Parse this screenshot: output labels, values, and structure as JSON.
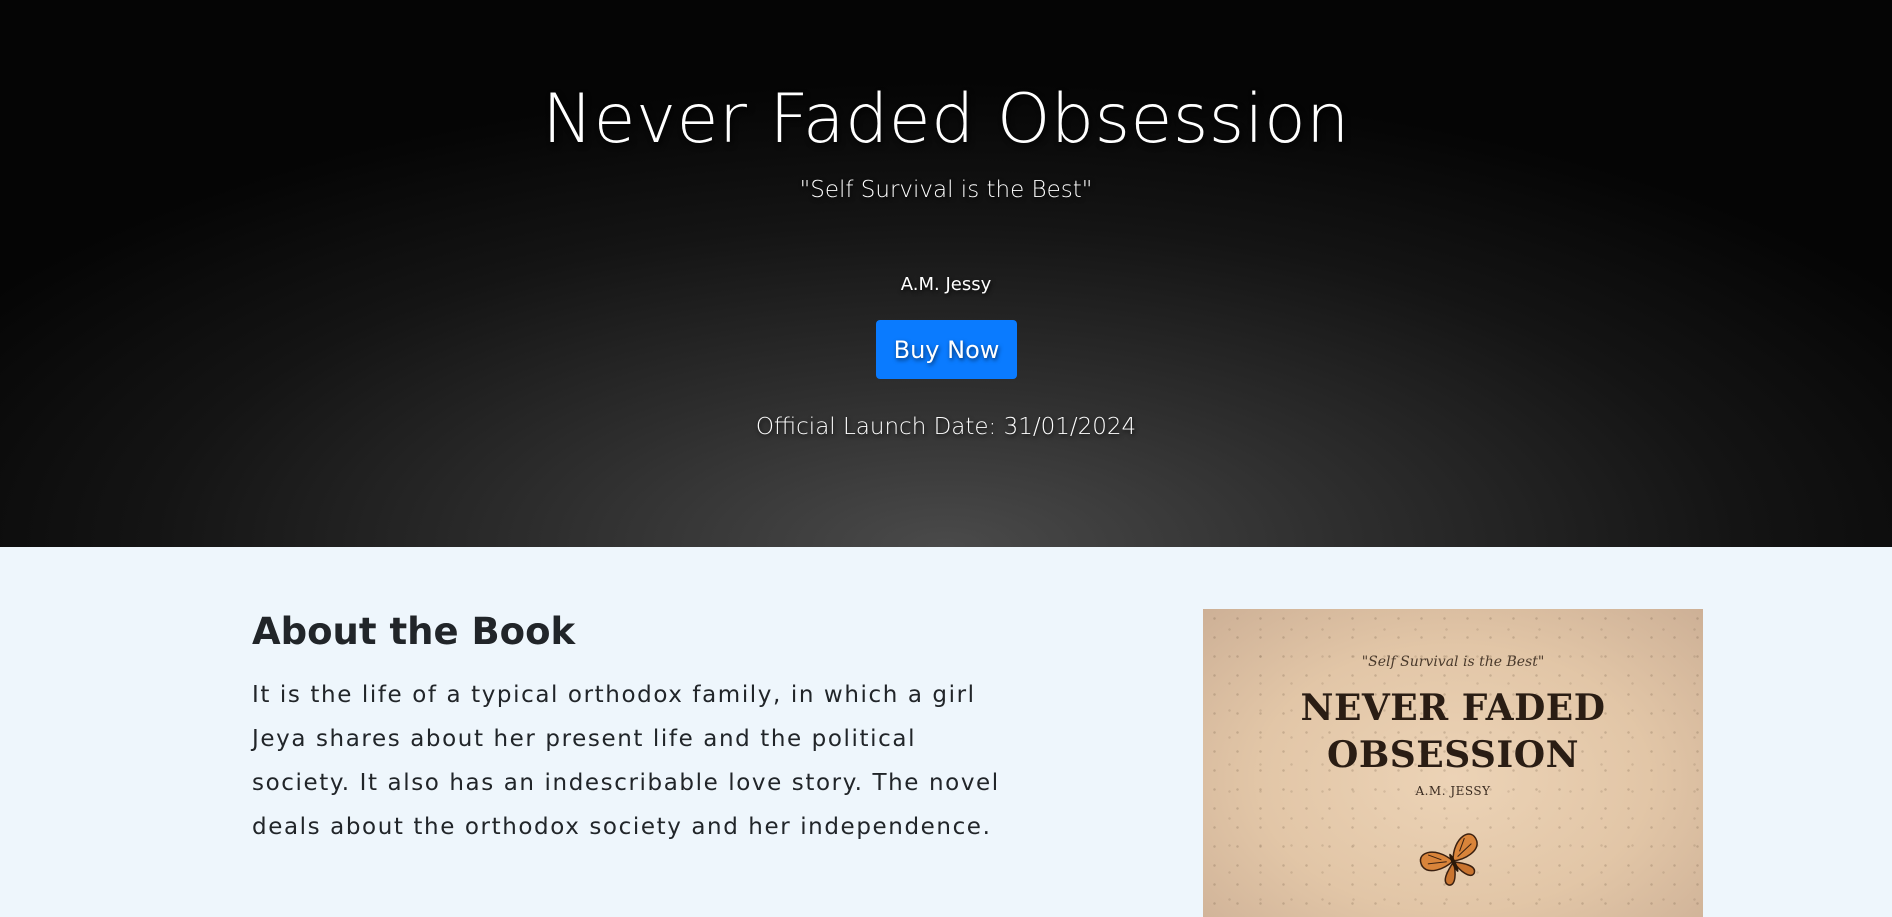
{
  "hero": {
    "title": "Never Faded Obsession",
    "tagline": "\"Self Survival is the Best\"",
    "author": "A.M. Jessy",
    "buy_label": "Buy Now",
    "launch_text": "Official Launch Date: 31/01/2024"
  },
  "about": {
    "heading": "About the Book",
    "description": "It is the life of a typical orthodox family, in which a girl Jeya shares about her present life and the political society. It also has an indescribable love story. The novel deals about the orthodox society and her independence."
  },
  "cover": {
    "tagline": "\"Self Survival is the Best\"",
    "title_line1": "NEVER FADED",
    "title_line2": "OBSESSION",
    "author": "A.M. JESSY",
    "icon": "butterfly-icon"
  },
  "colors": {
    "buy_button": "#0a7bff",
    "about_background": "#eef6fc",
    "hero_dark": "#050505"
  }
}
